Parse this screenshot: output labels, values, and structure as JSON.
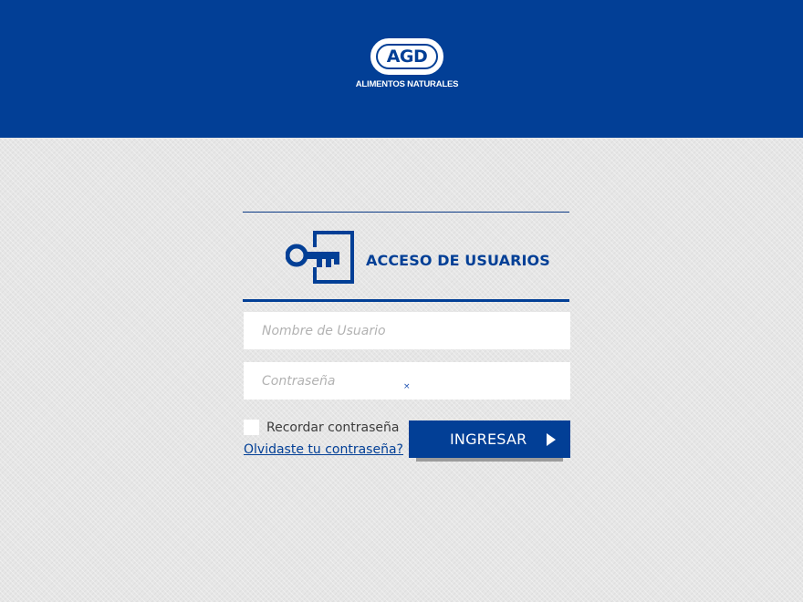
{
  "header": {
    "logo_text": "AGD",
    "logo_subtitle": "ALIMENTOS NATURALES"
  },
  "login": {
    "title": "ACCESO DE USUARIOS",
    "username_placeholder": "Nombre de Usuario",
    "username_value": "",
    "password_placeholder": "Contraseña",
    "password_value": "",
    "remember_label": "Recordar contraseña",
    "remember_checked": false,
    "forgot_link": "Olvidaste tu contraseña?",
    "submit_label": "INGRESAR"
  },
  "colors": {
    "brand_blue": "#023f96",
    "background": "#e6e6e6",
    "field_bg": "#ffffff"
  },
  "icons": [
    "key-icon",
    "arrow-right-icon"
  ]
}
